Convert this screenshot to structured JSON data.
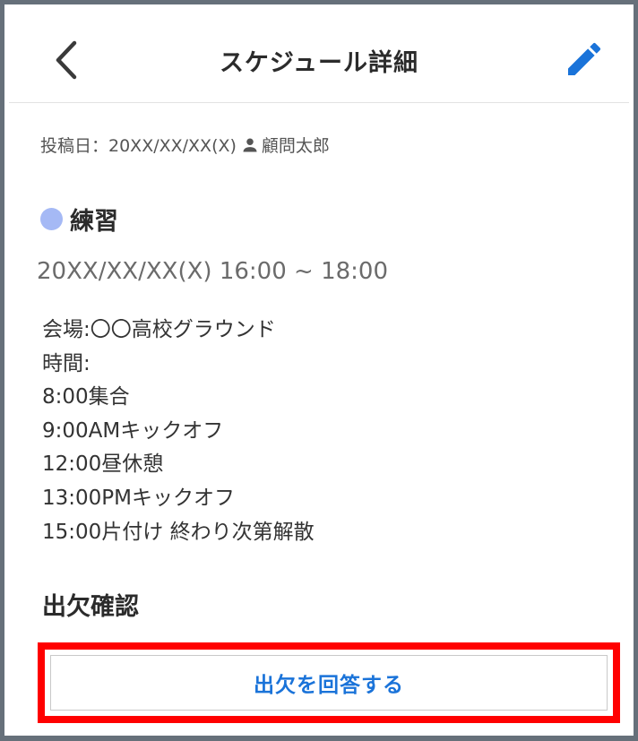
{
  "header": {
    "title": "スケジュール詳細",
    "back_icon": "chevron-left-icon",
    "edit_icon": "pencil-icon"
  },
  "post": {
    "posted_label": "投稿日：20XX/XX/XX(X)",
    "author_icon": "person-icon",
    "author": "顧問太郎"
  },
  "event": {
    "category": "練習",
    "category_color": "#a5b9f5",
    "datetime": "20XX/XX/XX(X) 16:00 ~ 18:00",
    "description": [
      "会場:〇〇高校グラウンド",
      "時間:",
      "8:00集合",
      "9:00AMキックオフ",
      "12:00昼休憩",
      "13:00PMキックオフ",
      "15:00片付け 終わり次第解散"
    ]
  },
  "attendance": {
    "section_title": "出欠確認",
    "answer_button": "出欠を回答する"
  },
  "colors": {
    "accent": "#1a73d9",
    "highlight": "#ff0000",
    "frame": "#66707a"
  }
}
